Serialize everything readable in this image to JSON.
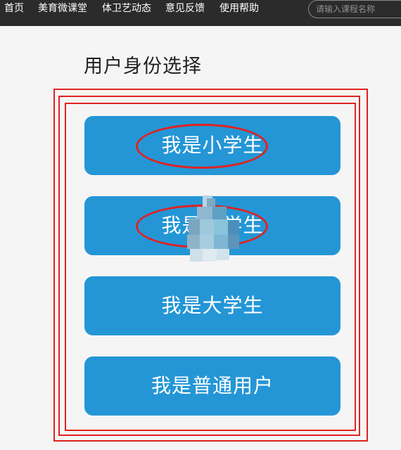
{
  "nav": {
    "items": [
      {
        "label": "首页"
      },
      {
        "label": "美育微课堂"
      },
      {
        "label": "体卫艺动态"
      },
      {
        "label": "意见反馈"
      },
      {
        "label": "使用帮助"
      }
    ],
    "search_placeholder": "请输入课程名称"
  },
  "page": {
    "title": "用户身份选择"
  },
  "roles": [
    {
      "label": "我是小学生"
    },
    {
      "label": "我是中学生"
    },
    {
      "label": "我是大学生"
    },
    {
      "label": "我是普通用户"
    }
  ],
  "colors": {
    "topbar": "#2b2b2b",
    "button": "#2496d6",
    "annotation": "#e02222",
    "background": "#f5f5f5"
  }
}
